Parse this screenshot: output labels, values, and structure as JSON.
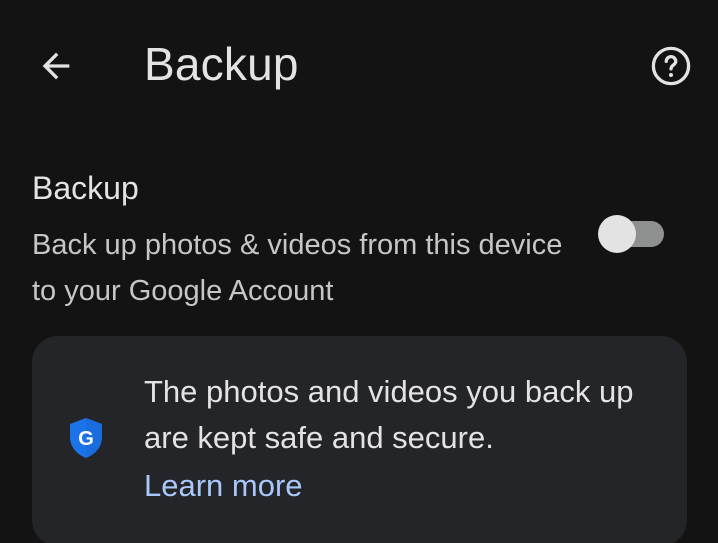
{
  "app_bar": {
    "title": "Backup",
    "back_icon": "arrow-back-icon",
    "help_icon": "help-outline-icon"
  },
  "backup_setting": {
    "title": "Backup",
    "description": "Back up photos & videos from this device to your Google Account",
    "enabled": false
  },
  "info_card": {
    "icon": "google-shield-icon",
    "text": "The photos and videos you back up are kept safe and secure.",
    "link_label": "Learn more"
  },
  "colors": {
    "background": "#131314",
    "card": "#242528",
    "text_primary": "#e3e3e3",
    "text_secondary": "#c4c7c5",
    "link": "#a8c7fa",
    "shield_blue": "#1a73e8"
  }
}
